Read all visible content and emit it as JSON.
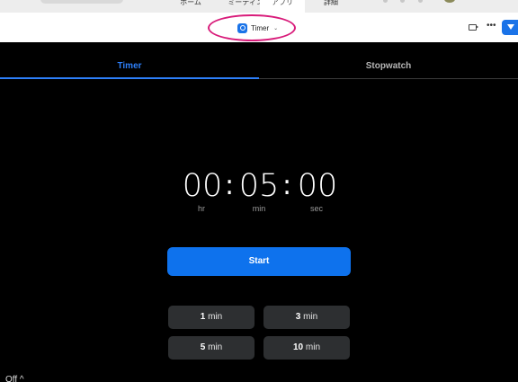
{
  "topbar": {
    "tabs": [
      {
        "label": "ホーム",
        "active": false
      },
      {
        "label": "ミーティング",
        "active": false
      },
      {
        "label": "アプリ",
        "active": true
      },
      {
        "label": "詳細",
        "active": false
      }
    ]
  },
  "header": {
    "app_name": "Timer",
    "app_icon": "timer-icon",
    "dropdown_icon": "chevron-down-icon",
    "video_icon": "video-icon",
    "more_icon": "more-icon",
    "apps_icon": "apps-icon"
  },
  "modes": {
    "timer": "Timer",
    "stopwatch": "Stopwatch"
  },
  "time": {
    "hours": "00",
    "minutes": "05",
    "seconds": "00",
    "separator": ":",
    "hours_unit": "hr",
    "minutes_unit": "min",
    "seconds_unit": "sec"
  },
  "start_label": "Start",
  "presets": [
    {
      "value": "1",
      "unit": "min"
    },
    {
      "value": "3",
      "unit": "min"
    },
    {
      "value": "5",
      "unit": "min"
    },
    {
      "value": "10",
      "unit": "min"
    }
  ],
  "footer": {
    "status": "Off ^"
  },
  "colors": {
    "accent": "#0e72ed",
    "tab_active": "#2d7ff9",
    "highlight_ring": "#d81b7a",
    "preset_bg": "#2d2f31"
  }
}
